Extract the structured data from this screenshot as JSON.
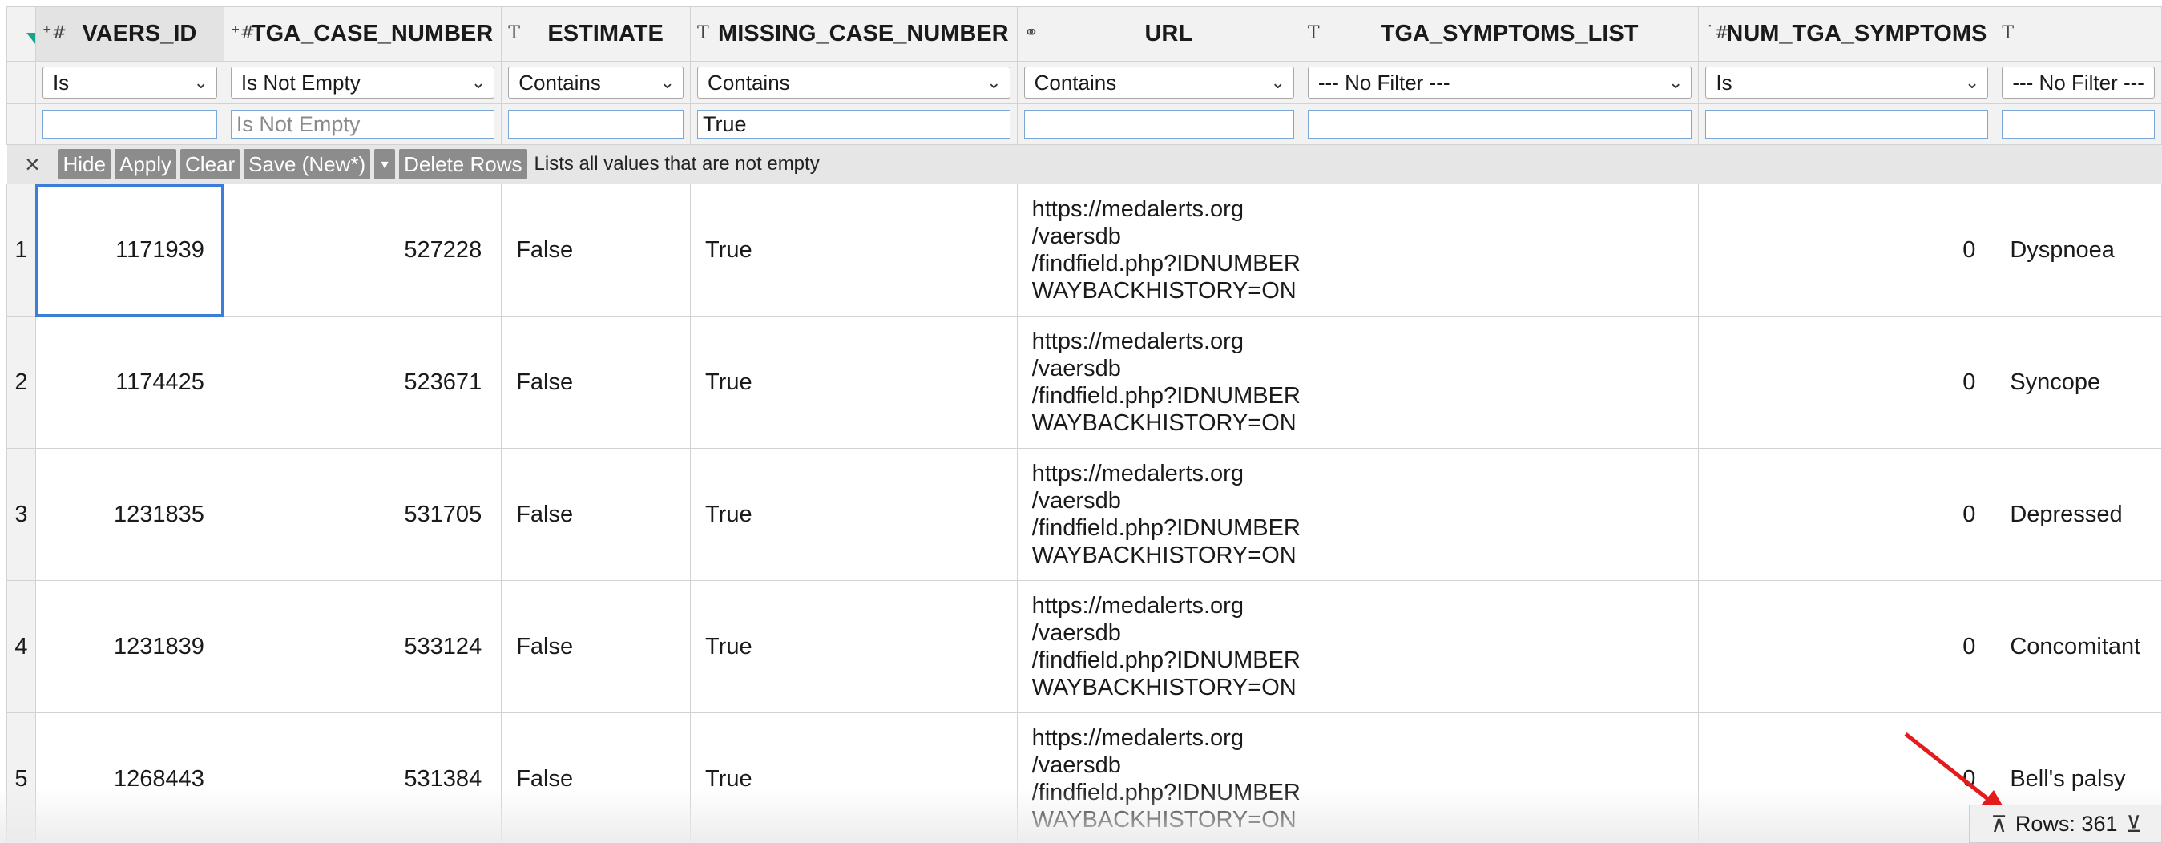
{
  "columns": [
    {
      "type_icon": "⁺#",
      "name": "VAERS_ID"
    },
    {
      "type_icon": "⁺#",
      "name": "TGA_CASE_NUMBER"
    },
    {
      "type_icon": "T",
      "name": "ESTIMATE"
    },
    {
      "type_icon": "T",
      "name": "MISSING_CASE_NUMBER"
    },
    {
      "type_icon": "⚭",
      "name": "URL"
    },
    {
      "type_icon": "T",
      "name": "TGA_SYMPTOMS_LIST"
    },
    {
      "type_icon": "˙#",
      "name": "NUM_TGA_SYMPTOMS"
    },
    {
      "type_icon": "T",
      "name": ""
    }
  ],
  "filters": [
    {
      "operator": "Is",
      "value": "",
      "placeholder": ""
    },
    {
      "operator": "Is Not Empty",
      "value": "",
      "placeholder": "Is Not Empty"
    },
    {
      "operator": "Contains",
      "value": "",
      "placeholder": ""
    },
    {
      "operator": "Contains",
      "value": "True",
      "placeholder": ""
    },
    {
      "operator": "Contains",
      "value": "",
      "placeholder": ""
    },
    {
      "operator": "--- No Filter ---",
      "value": "",
      "placeholder": ""
    },
    {
      "operator": "Is",
      "value": "",
      "placeholder": ""
    },
    {
      "operator": "--- No Filter ---",
      "value": "",
      "placeholder": ""
    }
  ],
  "actions": {
    "hide": "Hide",
    "apply": "Apply",
    "clear": "Clear",
    "save": "Save (New*)",
    "delete_rows": "Delete Rows",
    "hint": "Lists all values that are not empty"
  },
  "rows": [
    {
      "n": "1",
      "vaers_id": "1171939",
      "tga": "527228",
      "estimate": "False",
      "missing": "True",
      "url": [
        "https://medalerts.org",
        "/vaersdb",
        "/findfield.php?IDNUMBER",
        "WAYBACKHISTORY=ON"
      ],
      "symptoms": "",
      "num": "0",
      "last": "Dyspnoea"
    },
    {
      "n": "2",
      "vaers_id": "1174425",
      "tga": "523671",
      "estimate": "False",
      "missing": "True",
      "url": [
        "https://medalerts.org",
        "/vaersdb",
        "/findfield.php?IDNUMBER",
        "WAYBACKHISTORY=ON"
      ],
      "symptoms": "",
      "num": "0",
      "last": "Syncope"
    },
    {
      "n": "3",
      "vaers_id": "1231835",
      "tga": "531705",
      "estimate": "False",
      "missing": "True",
      "url": [
        "https://medalerts.org",
        "/vaersdb",
        "/findfield.php?IDNUMBER",
        "WAYBACKHISTORY=ON"
      ],
      "symptoms": "",
      "num": "0",
      "last": "Depressed"
    },
    {
      "n": "4",
      "vaers_id": "1231839",
      "tga": "533124",
      "estimate": "False",
      "missing": "True",
      "url": [
        "https://medalerts.org",
        "/vaersdb",
        "/findfield.php?IDNUMBER",
        "WAYBACKHISTORY=ON"
      ],
      "symptoms": "",
      "num": "0",
      "last": "Concomitant"
    },
    {
      "n": "5",
      "vaers_id": "1268443",
      "tga": "531384",
      "estimate": "False",
      "missing": "True",
      "url": [
        "https://medalerts.org",
        "/vaersdb",
        "/findfield.php?IDNUMBER",
        "WAYBACKHISTORY=ON"
      ],
      "symptoms": "",
      "num": "0",
      "last": "Bell's palsy"
    }
  ],
  "status": {
    "rows_label": "Rows: 361"
  },
  "colors": {
    "accent": "#3b7dd8",
    "funnel": "#17a589",
    "annotation_arrow": "#e31b1b"
  }
}
